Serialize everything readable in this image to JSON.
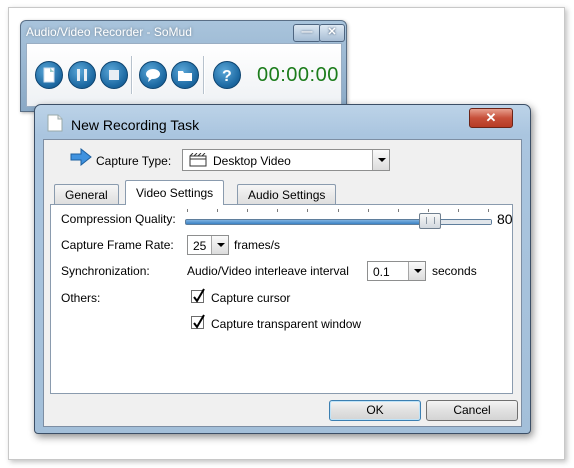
{
  "recorder": {
    "title": "Audio/Video Recorder - SoMud",
    "timer": "00:00:00",
    "controls": {
      "minimize": "—",
      "close": "✕"
    }
  },
  "dialog": {
    "title": "New Recording Task",
    "close_glyph": "✕",
    "capture_type": {
      "label": "Capture Type:",
      "value": "Desktop Video"
    },
    "tabs": [
      {
        "label": "General",
        "active": false
      },
      {
        "label": "Video Settings",
        "active": true
      },
      {
        "label": "Audio Settings",
        "active": false
      }
    ],
    "video_settings": {
      "compression": {
        "label": "Compression Quality:",
        "value": "80",
        "fraction": 0.8
      },
      "frame_rate": {
        "label": "Capture Frame Rate:",
        "value": "25",
        "unit": "frames/s"
      },
      "sync": {
        "label": "Synchronization:",
        "desc": "Audio/Video interleave interval",
        "value": "0.1",
        "unit": "seconds"
      },
      "others": {
        "label": "Others:",
        "capture_cursor": {
          "label": "Capture cursor",
          "checked": true
        },
        "capture_transparent": {
          "label": "Capture transparent window",
          "checked": true
        }
      }
    },
    "ok_label": "OK",
    "cancel_label": "Cancel"
  },
  "colors": {
    "accent": "#1d6aa3",
    "timer": "#1b7c1b",
    "close": "#c7503a"
  }
}
